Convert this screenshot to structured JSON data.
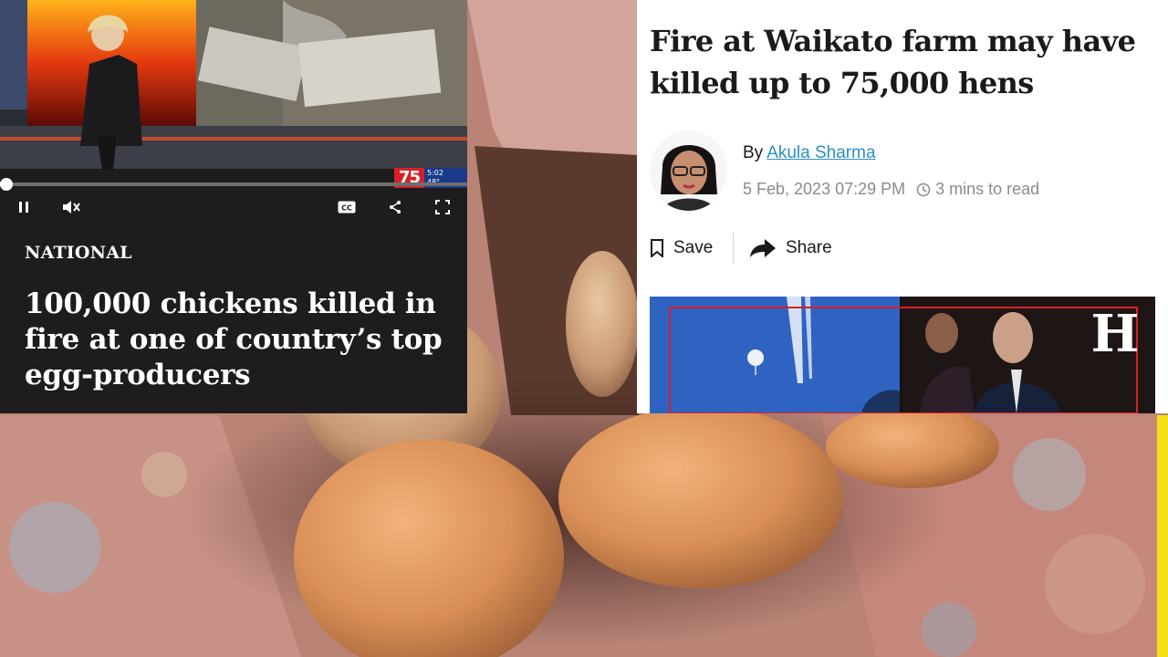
{
  "video_player": {
    "progress": 0.01,
    "controls": {
      "pause_icon": "pause-icon",
      "mute_icon": "muted-speaker-icon",
      "captions_label": "CC",
      "share_icon": "share-icon",
      "fullscreen_icon": "fullscreen-icon"
    },
    "badge": {
      "channel": "75",
      "time": "5:02",
      "temperature": "48°"
    },
    "section_label": "NATIONAL",
    "headline": "100,000 chickens killed in fire at one of country’s top egg-producers"
  },
  "article": {
    "title": "Fire at Waikato farm may have killed up to 75,000 hens",
    "byline_prefix": "By",
    "author": "Akula Sharma",
    "date": "5 Feb, 2023 07:29 PM",
    "read_time": "3 mins to read",
    "actions": {
      "save": "Save",
      "share": "Share"
    },
    "publisher_mark": "H"
  },
  "colors": {
    "link": "#2c8fbf",
    "meta_text": "#8b8b8b",
    "video_panel_bg": "#1d1d1d",
    "badge_red": "#d8202a",
    "badge_blue": "#1b3a8a",
    "accent_yellow": "#f2df18"
  }
}
